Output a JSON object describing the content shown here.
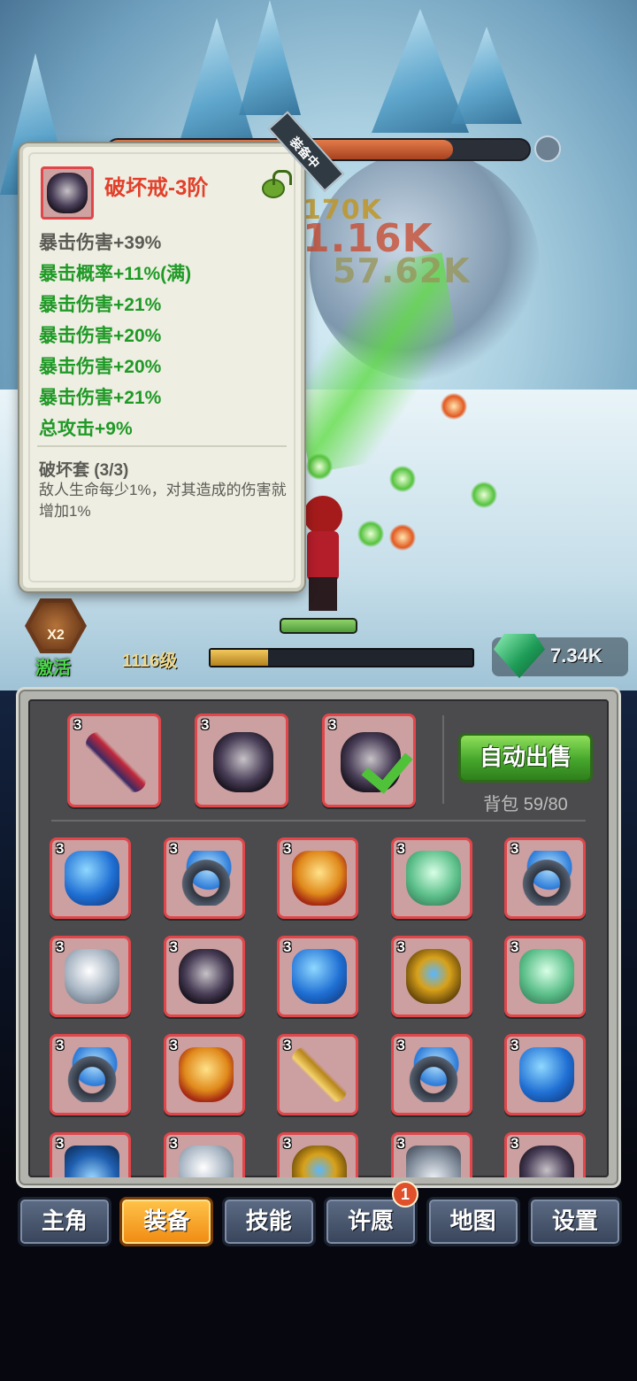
{
  "scene": {
    "damage_numbers": [
      "170K",
      "1.16K",
      "57.62K"
    ],
    "x2_badge": "X2",
    "activate_label": "激活",
    "level_label": "1116级",
    "xp_progress": 0.22,
    "gems_value": "7.34K",
    "enemy_hp_fraction": 0.82
  },
  "tooltip": {
    "title": "破坏戒-3阶",
    "ribbon": "装备中",
    "stats": [
      {
        "text": "暴击伤害+39%",
        "color": "gray"
      },
      {
        "text": "暴击概率+11%(满)",
        "color": "green"
      },
      {
        "text": "暴击伤害+21%",
        "color": "green"
      },
      {
        "text": "暴击伤害+20%",
        "color": "green"
      },
      {
        "text": "暴击伤害+20%",
        "color": "green"
      },
      {
        "text": "暴击伤害+21%",
        "color": "green"
      },
      {
        "text": "总攻击+9%",
        "color": "green"
      }
    ],
    "set_name": "破坏套  (3/3)",
    "set_desc": "敌人生命每少1%，对其造成的伤害就增加1%"
  },
  "equipped": [
    {
      "tier": "3",
      "icon": "staff-red-icon",
      "checked": false
    },
    {
      "tier": "3",
      "icon": "helm-dark-icon",
      "checked": false
    },
    {
      "tier": "3",
      "icon": "helm-dark-icon",
      "checked": true
    }
  ],
  "auto_sell_label": "自动出售",
  "bag_label": "背包 59/80",
  "inventory": [
    {
      "tier": "3",
      "icon": "armor-blue-icon"
    },
    {
      "tier": "3",
      "icon": "ring-blue-icon"
    },
    {
      "tier": "3",
      "icon": "armor-gold-icon"
    },
    {
      "tier": "3",
      "icon": "armor-green-icon"
    },
    {
      "tier": "3",
      "icon": "ring-blue-icon"
    },
    {
      "tier": "3",
      "icon": "armor-silver-icon"
    },
    {
      "tier": "3",
      "icon": "helm-dark-icon"
    },
    {
      "tier": "3",
      "icon": "armor-blue-icon"
    },
    {
      "tier": "3",
      "icon": "helm-gold-icon"
    },
    {
      "tier": "3",
      "icon": "armor-green-icon"
    },
    {
      "tier": "3",
      "icon": "ring-blue-icon"
    },
    {
      "tier": "3",
      "icon": "armor-gold-icon"
    },
    {
      "tier": "3",
      "icon": "sword-gold-icon"
    },
    {
      "tier": "3",
      "icon": "ring-blue-icon"
    },
    {
      "tier": "3",
      "icon": "armor-blue-icon"
    },
    {
      "tier": "3",
      "icon": "spiked-blue-icon"
    },
    {
      "tier": "3",
      "icon": "armor-silver-icon"
    },
    {
      "tier": "3",
      "icon": "helm-gold-icon"
    },
    {
      "tier": "3",
      "icon": "spiked-silver-icon"
    },
    {
      "tier": "3",
      "icon": "helm-dark-icon"
    }
  ],
  "tabs": [
    {
      "label": "主角",
      "active": false
    },
    {
      "label": "装备",
      "active": true
    },
    {
      "label": "技能",
      "active": false
    },
    {
      "label": "许愿",
      "active": false,
      "badge": "1"
    },
    {
      "label": "地图",
      "active": false
    },
    {
      "label": "设置",
      "active": false
    }
  ]
}
